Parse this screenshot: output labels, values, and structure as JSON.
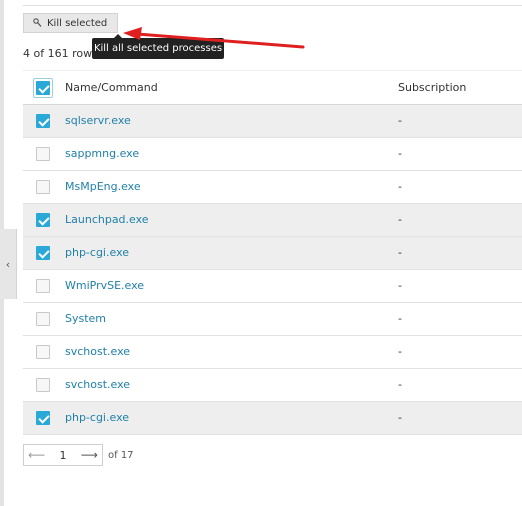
{
  "toolbar": {
    "kill_label": "Kill selected",
    "tooltip": "Kill all selected processes"
  },
  "rows_count": "4 of 161 rows",
  "table": {
    "header": {
      "name": "Name/Command",
      "subscription": "Subscription",
      "select_all_checked": true
    },
    "rows": [
      {
        "name": "sqlservr.exe",
        "subscription": "-",
        "checked": true
      },
      {
        "name": "sappmng.exe",
        "subscription": "-",
        "checked": false
      },
      {
        "name": "MsMpEng.exe",
        "subscription": "-",
        "checked": false
      },
      {
        "name": "Launchpad.exe",
        "subscription": "-",
        "checked": true
      },
      {
        "name": "php-cgi.exe",
        "subscription": "-",
        "checked": true
      },
      {
        "name": "WmiPrvSE.exe",
        "subscription": "-",
        "checked": false
      },
      {
        "name": "System",
        "subscription": "-",
        "checked": false
      },
      {
        "name": "svchost.exe",
        "subscription": "-",
        "checked": false
      },
      {
        "name": "svchost.exe",
        "subscription": "-",
        "checked": false
      },
      {
        "name": "php-cgi.exe",
        "subscription": "-",
        "checked": true
      }
    ]
  },
  "pagination": {
    "current_page": "1",
    "of_label": "of 17",
    "prev_icon": "arrow-left-icon",
    "next_icon": "arrow-right-icon"
  },
  "sidebar_toggle_icon": "chevron-left-icon",
  "colors": {
    "accent": "#2aa8d8",
    "link": "#1f7fa8",
    "selected_row": "#eeeeee",
    "annotation_arrow": "#e02020",
    "tooltip_bg": "#222222"
  }
}
